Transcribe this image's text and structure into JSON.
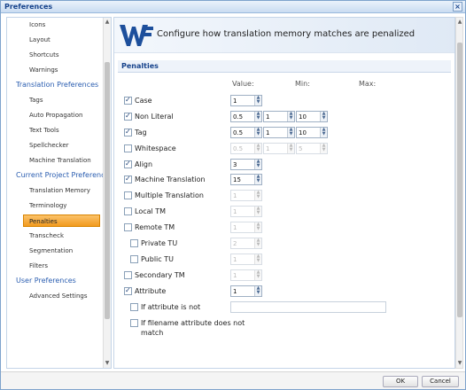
{
  "window": {
    "title": "Preferences",
    "close": "×"
  },
  "sidebar": {
    "items": [
      {
        "label": "Icons",
        "type": "item"
      },
      {
        "label": "Layout",
        "type": "item"
      },
      {
        "label": "Shortcuts",
        "type": "item"
      },
      {
        "label": "Warnings",
        "type": "item"
      },
      {
        "label": "Translation Preferences",
        "type": "header"
      },
      {
        "label": "Tags",
        "type": "item"
      },
      {
        "label": "Auto Propagation",
        "type": "item"
      },
      {
        "label": "Text Tools",
        "type": "item"
      },
      {
        "label": "Spellchecker",
        "type": "item"
      },
      {
        "label": "Machine Translation",
        "type": "item"
      },
      {
        "label": "Current Project Preferences",
        "type": "header"
      },
      {
        "label": "Translation Memory",
        "type": "item"
      },
      {
        "label": "Terminology",
        "type": "item"
      },
      {
        "label": "Penalties",
        "type": "item",
        "active": true
      },
      {
        "label": "Transcheck",
        "type": "item"
      },
      {
        "label": "Segmentation",
        "type": "item"
      },
      {
        "label": "Filters",
        "type": "item"
      },
      {
        "label": "User Preferences",
        "type": "header"
      },
      {
        "label": "Advanced Settings",
        "type": "item"
      }
    ]
  },
  "banner": {
    "text": "Configure how translation memory matches are penalized"
  },
  "section": {
    "title": "Penalties"
  },
  "columns": {
    "value": "Value:",
    "min": "Min:",
    "max": "Max:"
  },
  "penalties": {
    "case": {
      "label": "Case",
      "checked": true,
      "value": "1"
    },
    "non_literal": {
      "label": "Non Literal",
      "checked": true,
      "value": "0.5",
      "min": "1",
      "max": "10"
    },
    "tag": {
      "label": "Tag",
      "checked": true,
      "value": "0.5",
      "min": "1",
      "max": "10"
    },
    "whitespace": {
      "label": "Whitespace",
      "checked": false,
      "value": "0.5",
      "min": "1",
      "max": "5"
    },
    "align": {
      "label": "Align",
      "checked": true,
      "value": "3"
    },
    "machine_translation": {
      "label": "Machine Translation",
      "checked": true,
      "value": "15"
    },
    "multiple_translation": {
      "label": "Multiple Translation",
      "checked": false,
      "value": "1"
    },
    "local_tm": {
      "label": "Local TM",
      "checked": false,
      "value": "1"
    },
    "remote_tm": {
      "label": "Remote TM",
      "checked": false,
      "value": "1"
    },
    "private_tu": {
      "label": "Private TU",
      "checked": false,
      "value": "2"
    },
    "public_tu": {
      "label": "Public TU",
      "checked": false,
      "value": "1"
    },
    "secondary_tm": {
      "label": "Secondary TM",
      "checked": false,
      "value": "1"
    },
    "attribute": {
      "label": "Attribute",
      "checked": true,
      "value": "1"
    },
    "if_attribute_not": {
      "label": "If attribute is not",
      "checked": false,
      "value": ""
    },
    "if_filename_attr_line1": "If filename attribute does not",
    "if_filename_attr_line2": "match",
    "if_filename_attr_checked": false
  },
  "footer": {
    "ok": "OK",
    "cancel": "Cancel"
  },
  "colors": {
    "accent": "#15428b",
    "active": "#f29a1e",
    "header": "#2a5db0"
  }
}
